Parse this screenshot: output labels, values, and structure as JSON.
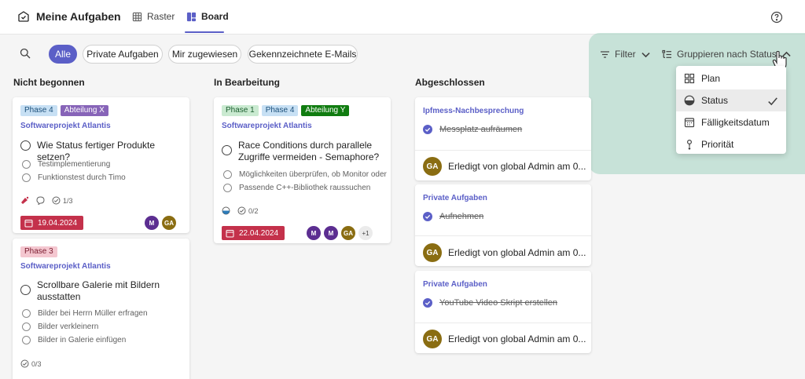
{
  "app": {
    "title": "Meine Aufgaben"
  },
  "tabs": [
    {
      "label": "Raster",
      "active": false
    },
    {
      "label": "Board",
      "active": true
    }
  ],
  "filters": [
    "Alle",
    "Private Aufgaben",
    "Mir zugewiesen",
    "Gekennzeichnete E-Mails"
  ],
  "toolbar": {
    "filter_label": "Filter",
    "group_label": "Gruppieren nach Status"
  },
  "group_menu": {
    "items": [
      {
        "label": "Plan",
        "icon": "grid-icon",
        "selected": false
      },
      {
        "label": "Status",
        "icon": "half-circle-icon",
        "selected": true
      },
      {
        "label": "Fälligkeitsdatum",
        "icon": "calendar-icon",
        "selected": false
      },
      {
        "label": "Priorität",
        "icon": "priority-icon",
        "selected": false
      }
    ]
  },
  "columns": [
    {
      "title": "Nicht begonnen",
      "cards": [
        {
          "labels": [
            {
              "text": "Phase 4",
              "bg": "#c7e0f4",
              "fg": "#1b4f7a"
            },
            {
              "text": "Abteilung X",
              "bg": "#8764b8",
              "fg": "#ffffff"
            }
          ],
          "project": "Softwareprojekt Atlantis",
          "title_lines": [
            "Wie Status fertiger Produkte setzen?"
          ],
          "subtasks": [
            "Testimplementierung",
            "Funktionstest durch Timo"
          ],
          "checklist_count": "1/3",
          "due": "19.04.2024",
          "assignees": [
            {
              "initials": "M",
              "color": "#5c2e91"
            },
            {
              "initials": "GA",
              "color": "#8a6d12"
            }
          ]
        },
        {
          "labels": [
            {
              "text": "Phase 3",
              "bg": "#f4c7d0",
              "fg": "#7a1b2e"
            }
          ],
          "project": "Softwareprojekt Atlantis",
          "title_lines": [
            "Scrollbare Galerie mit Bildern",
            "ausstatten"
          ],
          "subtasks": [
            "Bilder bei Herrn Müller erfragen",
            "Bilder verkleinern",
            "Bilder in Galerie einfügen"
          ],
          "checklist_count": "0/3"
        }
      ]
    },
    {
      "title": "In Bearbeitung",
      "cards": [
        {
          "labels": [
            {
              "text": "Phase 1",
              "bg": "#caead1",
              "fg": "#1b5e2e"
            },
            {
              "text": "Phase 4",
              "bg": "#c7e0f4",
              "fg": "#1b4f7a"
            },
            {
              "text": "Abteilung Y",
              "bg": "#107c10",
              "fg": "#ffffff"
            }
          ],
          "project": "Softwareprojekt Atlantis",
          "title_lines": [
            "Race Conditions durch parallele",
            "Zugriffe vermeiden - Semaphore?"
          ],
          "subtasks": [
            "Möglichkeiten überprüfen, ob Monitor oder",
            "Passende C++-Bibliothek raussuchen"
          ],
          "checklist_count": "0/2",
          "due": "22.04.2024",
          "assignees": [
            {
              "initials": "M",
              "color": "#5c2e91"
            },
            {
              "initials": "M",
              "color": "#5c2e91"
            },
            {
              "initials": "GA",
              "color": "#8a6d12"
            }
          ],
          "more_assignees": "+1"
        }
      ]
    },
    {
      "title": "Abgeschlossen",
      "cards": [
        {
          "plan": "Ipfmess-Nachbesprechung",
          "task": "Messplatz aufräumen",
          "initials": "GA",
          "completed_text": "Erledigt von global Admin am 0..."
        },
        {
          "plan": "Private Aufgaben",
          "task": "Aufnehmen",
          "initials": "GA",
          "completed_text": "Erledigt von global Admin am 0..."
        },
        {
          "plan": "Private Aufgaben",
          "task": "YouTube Video Skript erstellen",
          "initials": "GA",
          "completed_text": "Erledigt von global Admin am 0..."
        }
      ]
    }
  ]
}
